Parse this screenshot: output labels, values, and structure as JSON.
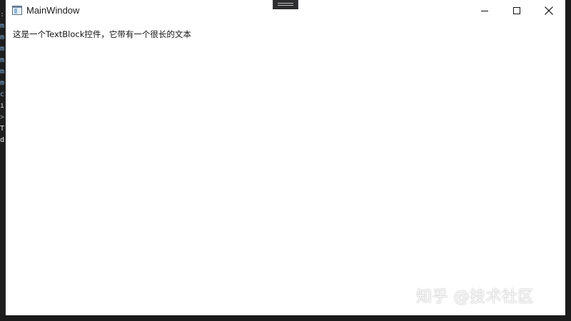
{
  "window": {
    "title": "MainWindow"
  },
  "content": {
    "textblock_text": "这是一个TextBlock控件，它带有一个很长的文本"
  },
  "watermark": {
    "text": "知乎 @技术社区"
  },
  "editor_gutter": {
    "chars": [
      ":",
      "m",
      "m",
      "m",
      "m",
      "m",
      "m",
      "c",
      "i",
      ">",
      "T",
      "d"
    ]
  },
  "icons": {
    "app": "window-app-icon",
    "minimize": "minimize-icon",
    "maximize": "maximize-icon",
    "close": "close-icon"
  },
  "colors": {
    "window_bg": "#ffffff",
    "backdrop": "#1f1f1f",
    "text": "#111111"
  }
}
